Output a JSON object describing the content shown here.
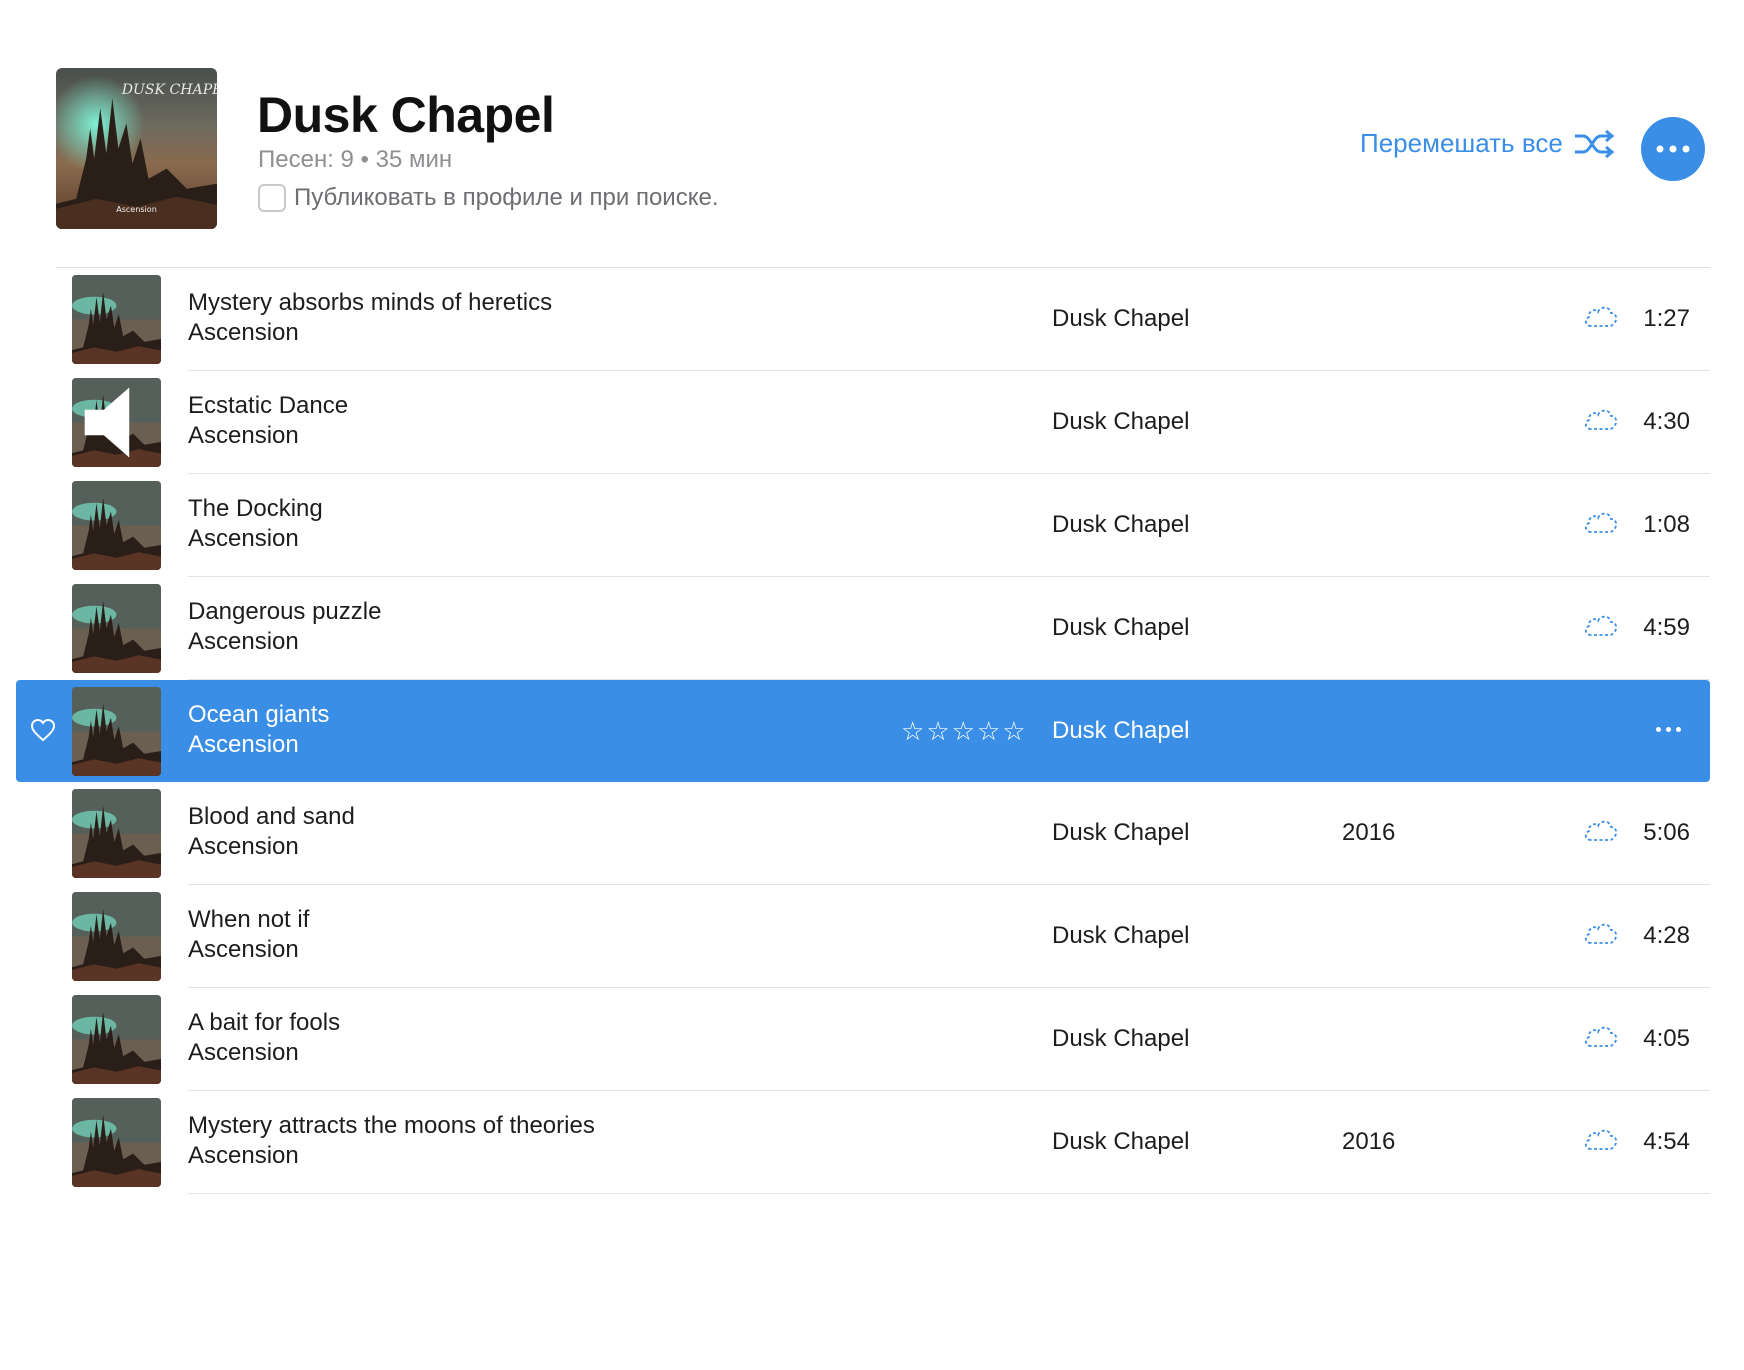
{
  "header": {
    "title": "Dusk Chapel",
    "meta": "Песен: 9 • 35 мин",
    "publish_label": "Публиковать в профиле и при поиске.",
    "publish_checked": false,
    "shuffle_label": "Перемешать все",
    "accent_color": "#3a8ee6"
  },
  "album_art": {
    "band_logo": "DUSK CHAPEL",
    "album_caption": "Ascension"
  },
  "tracks": [
    {
      "title": "Mystery absorbs minds of heretics",
      "album": "Ascension",
      "artist": "Dusk Chapel",
      "year": "",
      "duration": "1:27"
    },
    {
      "title": "Ecstatic Dance",
      "album": "Ascension",
      "artist": "Dusk Chapel",
      "year": "",
      "duration": "4:30",
      "playing": true
    },
    {
      "title": "The Docking",
      "album": "Ascension",
      "artist": "Dusk Chapel",
      "year": "",
      "duration": "1:08"
    },
    {
      "title": "Dangerous puzzle",
      "album": "Ascension",
      "artist": "Dusk Chapel",
      "year": "",
      "duration": "4:59"
    },
    {
      "title": "Ocean giants",
      "album": "Ascension",
      "artist": "Dusk Chapel",
      "year": "",
      "duration": "",
      "selected": true,
      "rating": 0
    },
    {
      "title": "Blood and sand",
      "album": "Ascension",
      "artist": "Dusk Chapel",
      "year": "2016",
      "duration": "5:06"
    },
    {
      "title": "When not if",
      "album": "Ascension",
      "artist": "Dusk Chapel",
      "year": "",
      "duration": "4:28"
    },
    {
      "title": "A bait for fools",
      "album": "Ascension",
      "artist": "Dusk Chapel",
      "year": "",
      "duration": "4:05"
    },
    {
      "title": "Mystery attracts the moons of theories",
      "album": "Ascension",
      "artist": "Dusk Chapel",
      "year": "2016",
      "duration": "4:54"
    }
  ],
  "icons": {
    "shuffle": "shuffle-icon",
    "more": "more-icon",
    "cloud": "cloud-download-icon",
    "speaker": "speaker-icon",
    "heart": "heart-icon",
    "star": "star-icon"
  }
}
